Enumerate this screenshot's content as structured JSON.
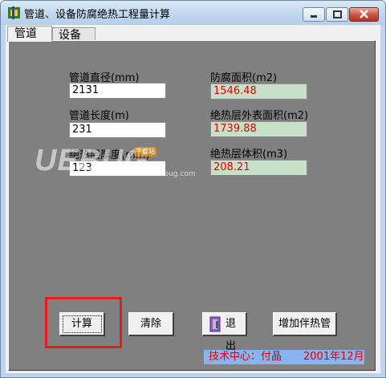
{
  "window": {
    "title": "管道、设备防腐绝热工程量计算"
  },
  "tabs": [
    {
      "label": "管道"
    },
    {
      "label": "设备"
    }
  ],
  "inputs": {
    "diameter": {
      "label": "管道直径(mm)",
      "value": "2131"
    },
    "length": {
      "label": "管道长度(m)",
      "value": "231"
    },
    "thickness": {
      "label": "绝热层厚度(mm)",
      "value": "123"
    }
  },
  "outputs": {
    "anticorrosion_area": {
      "label": "防腐面积(m2)",
      "value": "1546.48"
    },
    "insulation_outer_area": {
      "label": "绝热层外表面积(m2)",
      "value": "1739.88"
    },
    "insulation_volume": {
      "label": "绝热层体积(m3)",
      "value": "208.21"
    }
  },
  "buttons": {
    "calculate": "计算",
    "clear": "清除",
    "exit": "退出",
    "add_tracing": "增加伴热管"
  },
  "footer": {
    "credit": "技术中心：付晶",
    "date": "2001年12月"
  },
  "watermark": {
    "brand": "UEBUG",
    "tag": "下载站",
    "url": "www.uebug.com"
  },
  "colors": {
    "output_text": "#e00000",
    "output_bg": "#c8e0c8",
    "panel_bg": "#808080",
    "highlight": "#e11e1e",
    "footer_bg": "#87b4ee"
  }
}
